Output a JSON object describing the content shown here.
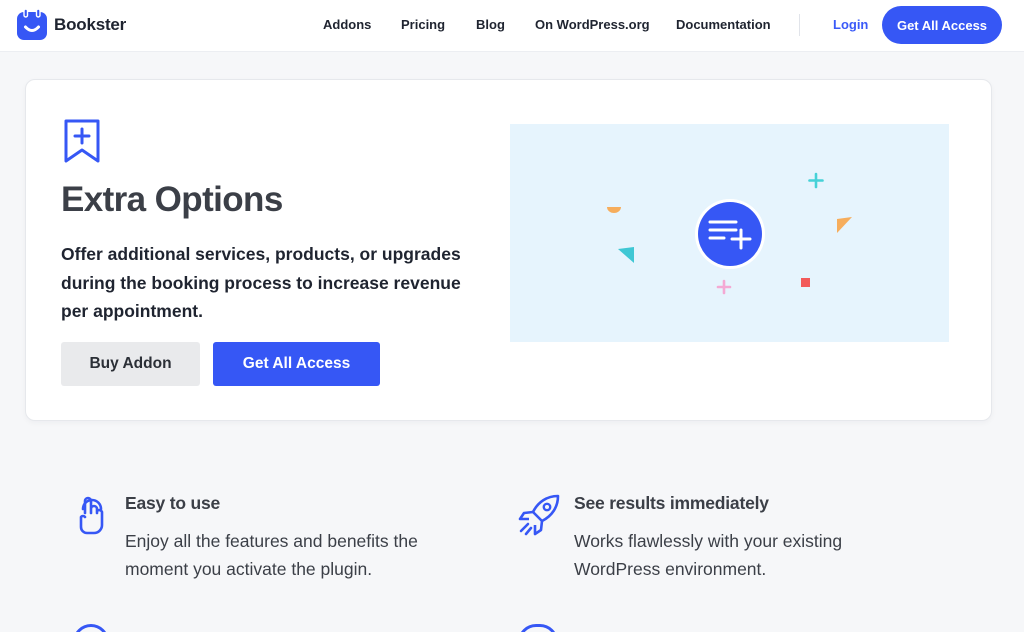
{
  "brand": {
    "name": "Bookster",
    "color": "#3657f5"
  },
  "nav": {
    "items": [
      "Addons",
      "Pricing",
      "Blog",
      "On WordPress.org",
      "Documentation"
    ],
    "login": "Login",
    "cta": "Get All Access"
  },
  "hero": {
    "icon": "bookmark-plus-icon",
    "title": "Extra Options",
    "description": "Offer additional services, products, or upgrades during the booking process to increase revenue per appointment.",
    "buy_button": "Buy Addon",
    "cta_button": "Get All Access",
    "illustration_icon": "list-plus-icon"
  },
  "features": [
    {
      "icon": "pointer-hand-icon",
      "title": "Easy to use",
      "description": "Enjoy all the features and benefits the moment you activate the plugin."
    },
    {
      "icon": "rocket-icon",
      "title": "See results immediately",
      "description": "Works flawlessly with your existing WordPress environment."
    }
  ]
}
